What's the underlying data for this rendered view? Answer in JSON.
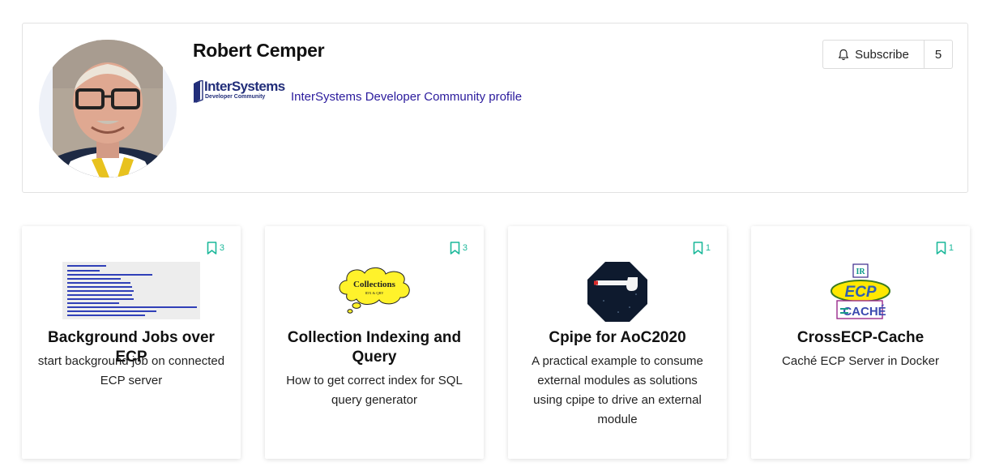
{
  "profile": {
    "name": "Robert Cemper",
    "logo_brand": "InterSystems",
    "logo_sub": "Developer Community",
    "link_text": "InterSystems Developer Community profile",
    "subscribe_label": "Subscribe",
    "subscriber_count": "5"
  },
  "apps": [
    {
      "title": "Background Jobs over ECP",
      "description": "start background job on connected ECP server",
      "bookmarks": "3",
      "image": "code-screenshot-thumbnail"
    },
    {
      "title": "Collection Indexing and Query",
      "description": "How to get correct index for SQL query generator",
      "bookmarks": "3",
      "image": "collections-cloud",
      "image_text": "Collections",
      "image_subtext": "IDX & QRY"
    },
    {
      "title": "Cpipe for AoC2020",
      "description": "A practical example to consume external modules as solutions using cpipe to drive an external module",
      "bookmarks": "1",
      "image": "pipe-octagon"
    },
    {
      "title": "CrossECP-Cache",
      "description": "Caché ECP Server in Docker",
      "bookmarks": "1",
      "image": "ecp-cache-logo",
      "image_top": "IR",
      "image_mid": "ECP",
      "image_bottom": "CACHÉ"
    }
  ],
  "colors": {
    "accent_teal": "#1bb89a",
    "link": "#2a1a9c",
    "brand_navy": "#222e7a"
  }
}
